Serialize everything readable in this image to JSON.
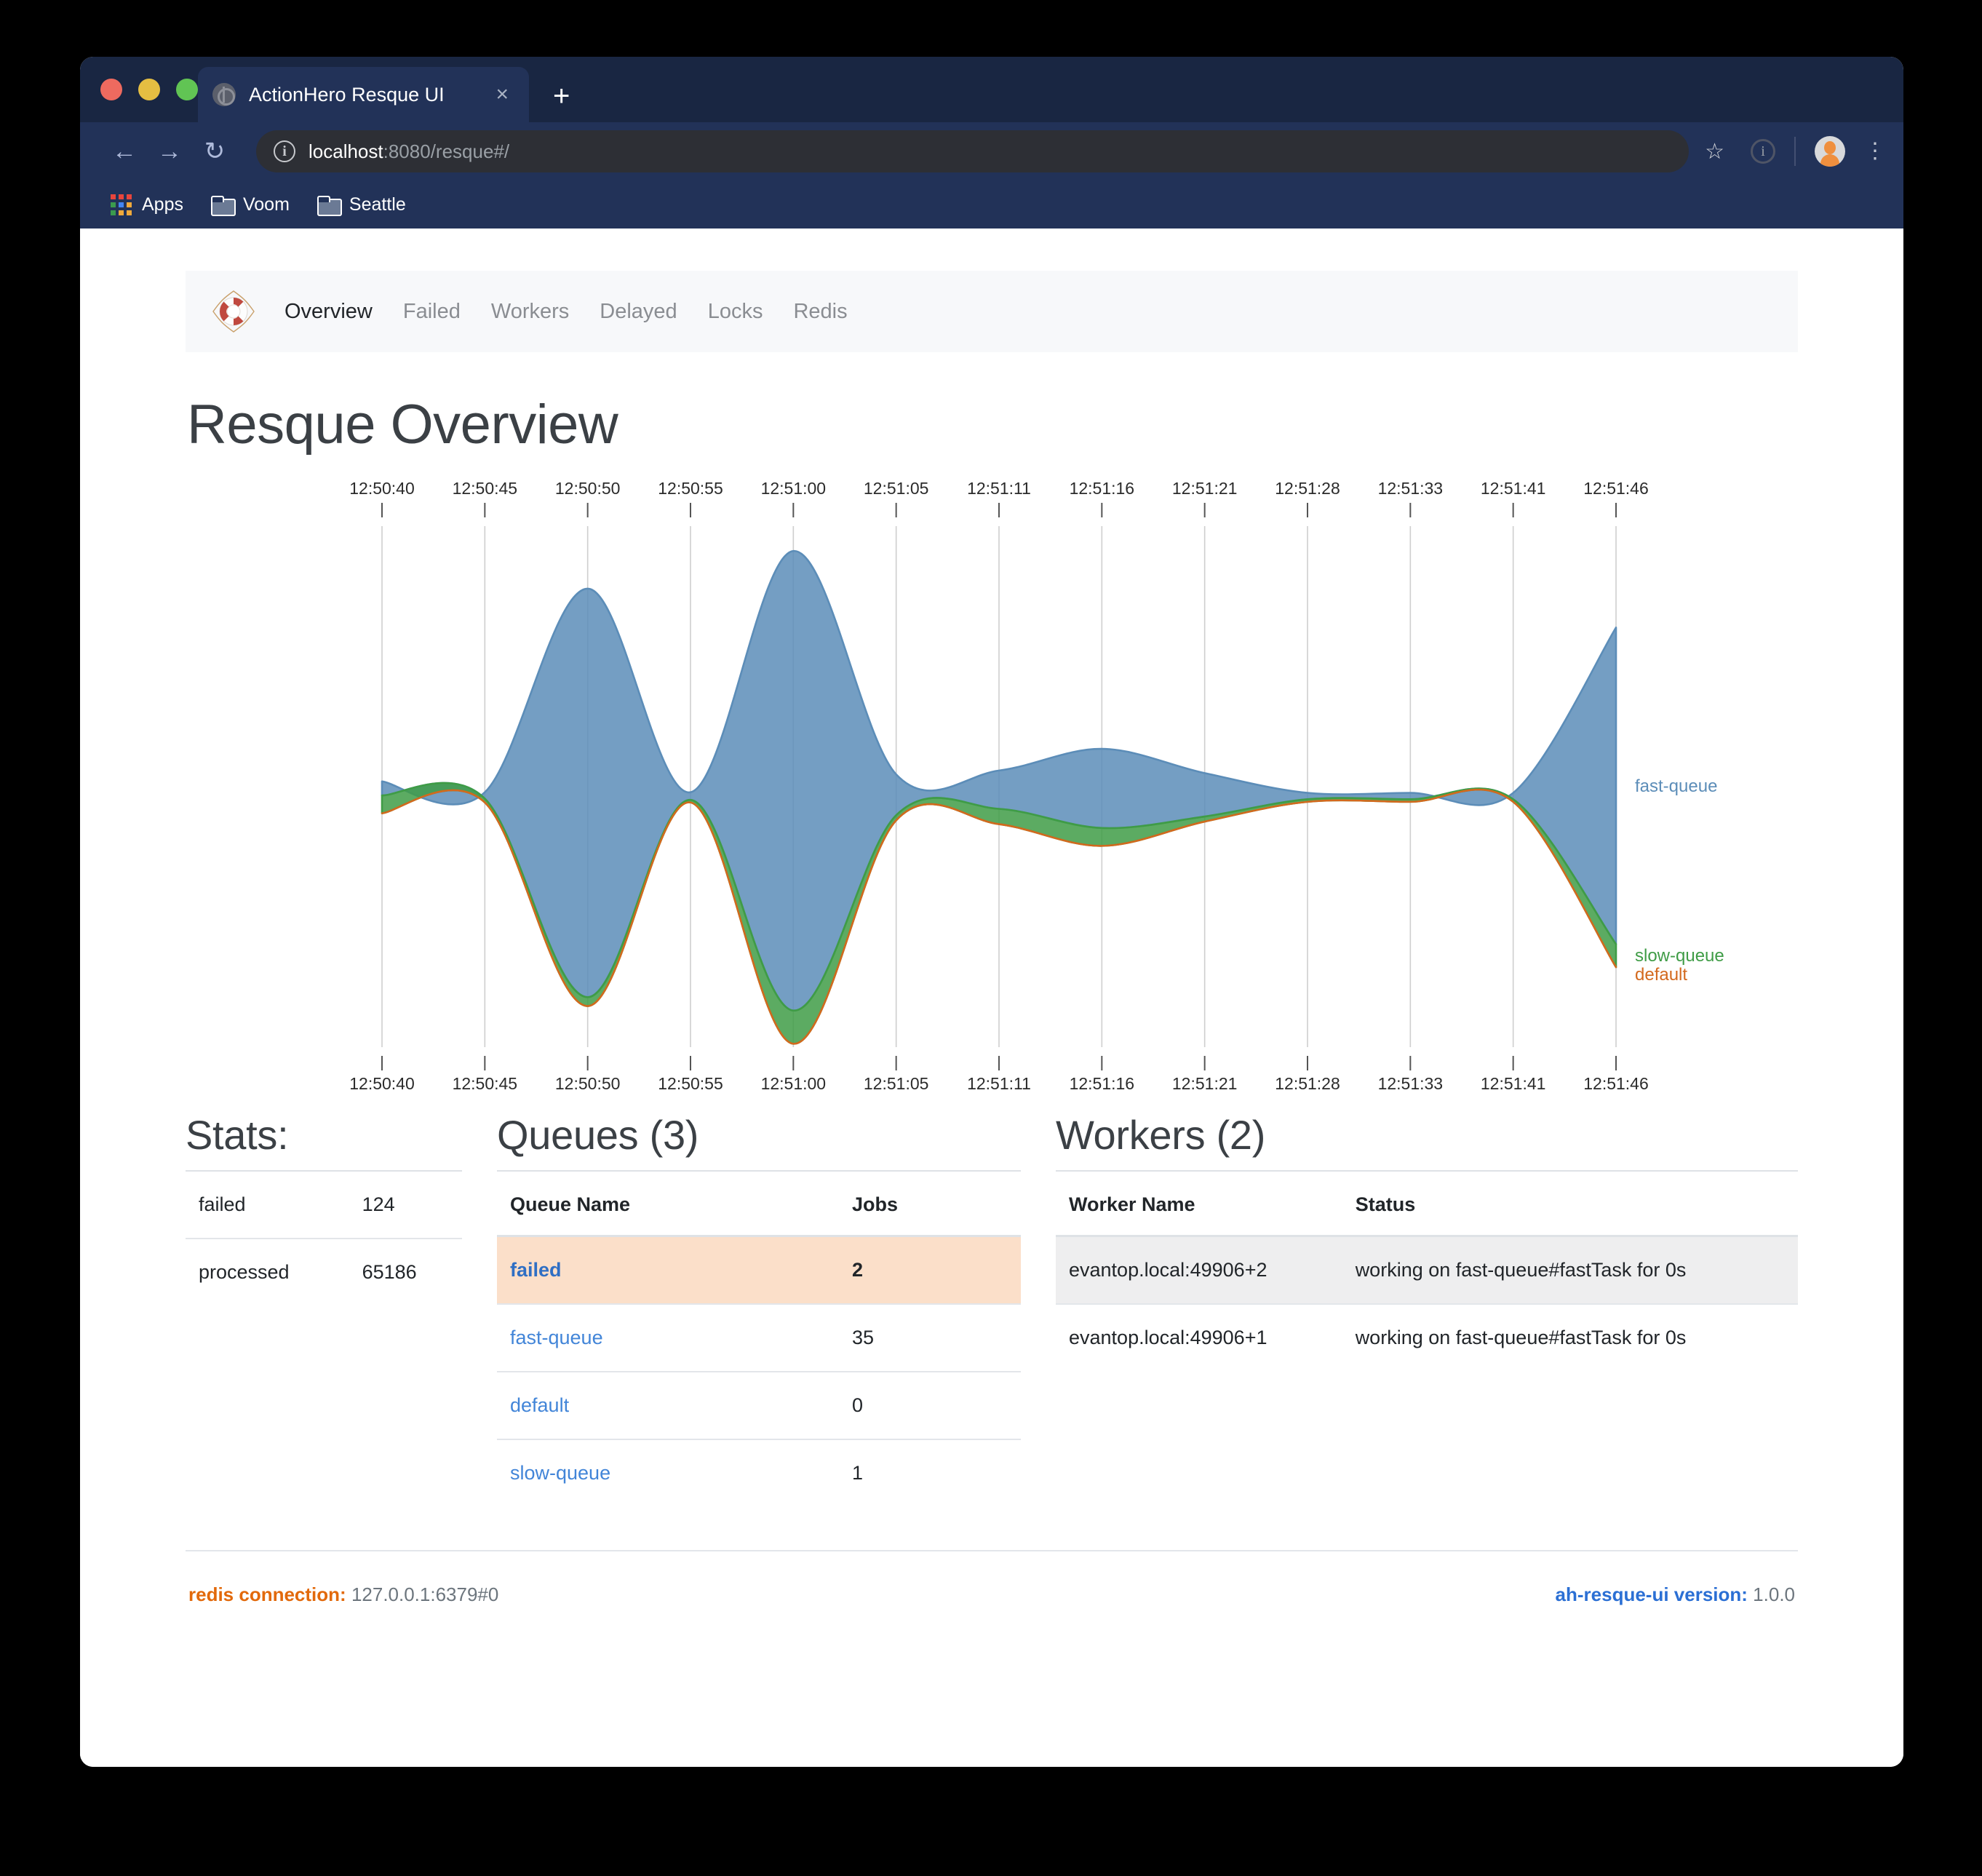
{
  "browser": {
    "tab": {
      "title": "ActionHero Resque UI",
      "favicon": "globe-icon",
      "close": "×"
    },
    "new_tab": "+",
    "nav": {
      "back": "←",
      "forward": "→",
      "reload": "↻"
    },
    "url": {
      "host": "localhost",
      "rest": ":8080/resque#/"
    },
    "bookmarks": [
      {
        "label": "Apps",
        "icon": "apps-grid-icon"
      },
      {
        "label": "Voom",
        "icon": "folder-icon"
      },
      {
        "label": "Seattle",
        "icon": "folder-icon"
      }
    ],
    "toolbar_icons": [
      "star-icon",
      "extension-info-icon",
      "avatar",
      "kebab-menu-icon"
    ],
    "colors": {
      "chrome_dark": "#192642",
      "chrome_bar": "#223258",
      "url_pill": "#2d2f35"
    }
  },
  "app": {
    "logo": "lifebuoy-icon",
    "nav_items": [
      {
        "label": "Overview",
        "active": true
      },
      {
        "label": "Failed",
        "active": false
      },
      {
        "label": "Workers",
        "active": false
      },
      {
        "label": "Delayed",
        "active": false
      },
      {
        "label": "Locks",
        "active": false
      },
      {
        "label": "Redis",
        "active": false
      }
    ],
    "page_title": "Resque Overview"
  },
  "chart_data": {
    "type": "area",
    "title": "",
    "xlabel": "",
    "ylabel": "",
    "grid": true,
    "legend_position": "right",
    "axis_top": true,
    "axis_bottom": true,
    "categories": [
      "12:50:40",
      "12:50:45",
      "12:50:50",
      "12:50:55",
      "12:51:00",
      "12:51:05",
      "12:51:11",
      "12:51:16",
      "12:51:21",
      "12:51:28",
      "12:51:33",
      "12:51:41",
      "12:51:46"
    ],
    "series": [
      {
        "name": "fast-queue",
        "color": "#5c8db8",
        "values": [
          11,
          5,
          320,
          6,
          360,
          32,
          30,
          62,
          34,
          5,
          5,
          5,
          248
        ]
      },
      {
        "name": "slow-queue",
        "color": "#3f9c46",
        "values": [
          14,
          3,
          7,
          2,
          26,
          4,
          12,
          14,
          4,
          2,
          2,
          2,
          18
        ]
      },
      {
        "name": "default",
        "color": "#d3691d",
        "values": [
          0,
          0,
          0,
          0,
          0,
          0,
          0,
          0,
          0,
          0,
          0,
          0,
          0
        ]
      }
    ],
    "offset": "wiggle"
  },
  "stats": {
    "title": "Stats:",
    "rows": [
      {
        "label": "failed",
        "value": "124"
      },
      {
        "label": "processed",
        "value": "65186"
      }
    ]
  },
  "queues": {
    "title": "Queues (3)",
    "headers": [
      "Queue Name",
      "Jobs"
    ],
    "rows": [
      {
        "name": "failed",
        "jobs": "2",
        "highlight": true
      },
      {
        "name": "fast-queue",
        "jobs": "35",
        "highlight": false
      },
      {
        "name": "default",
        "jobs": "0",
        "highlight": false
      },
      {
        "name": "slow-queue",
        "jobs": "1",
        "highlight": false
      }
    ]
  },
  "workers": {
    "title": "Workers (2)",
    "headers": [
      "Worker Name",
      "Status"
    ],
    "rows": [
      {
        "name": "evantop.local:49906+2",
        "status": "working on fast-queue#fastTask for 0s",
        "alt": true
      },
      {
        "name": "evantop.local:49906+1",
        "status": "working on fast-queue#fastTask for 0s",
        "alt": false
      }
    ]
  },
  "footer": {
    "redis_label": "redis connection:",
    "redis_value": "127.0.0.1:6379#0",
    "version_label": "ah-resque-ui version:",
    "version_value": "1.0.0"
  }
}
